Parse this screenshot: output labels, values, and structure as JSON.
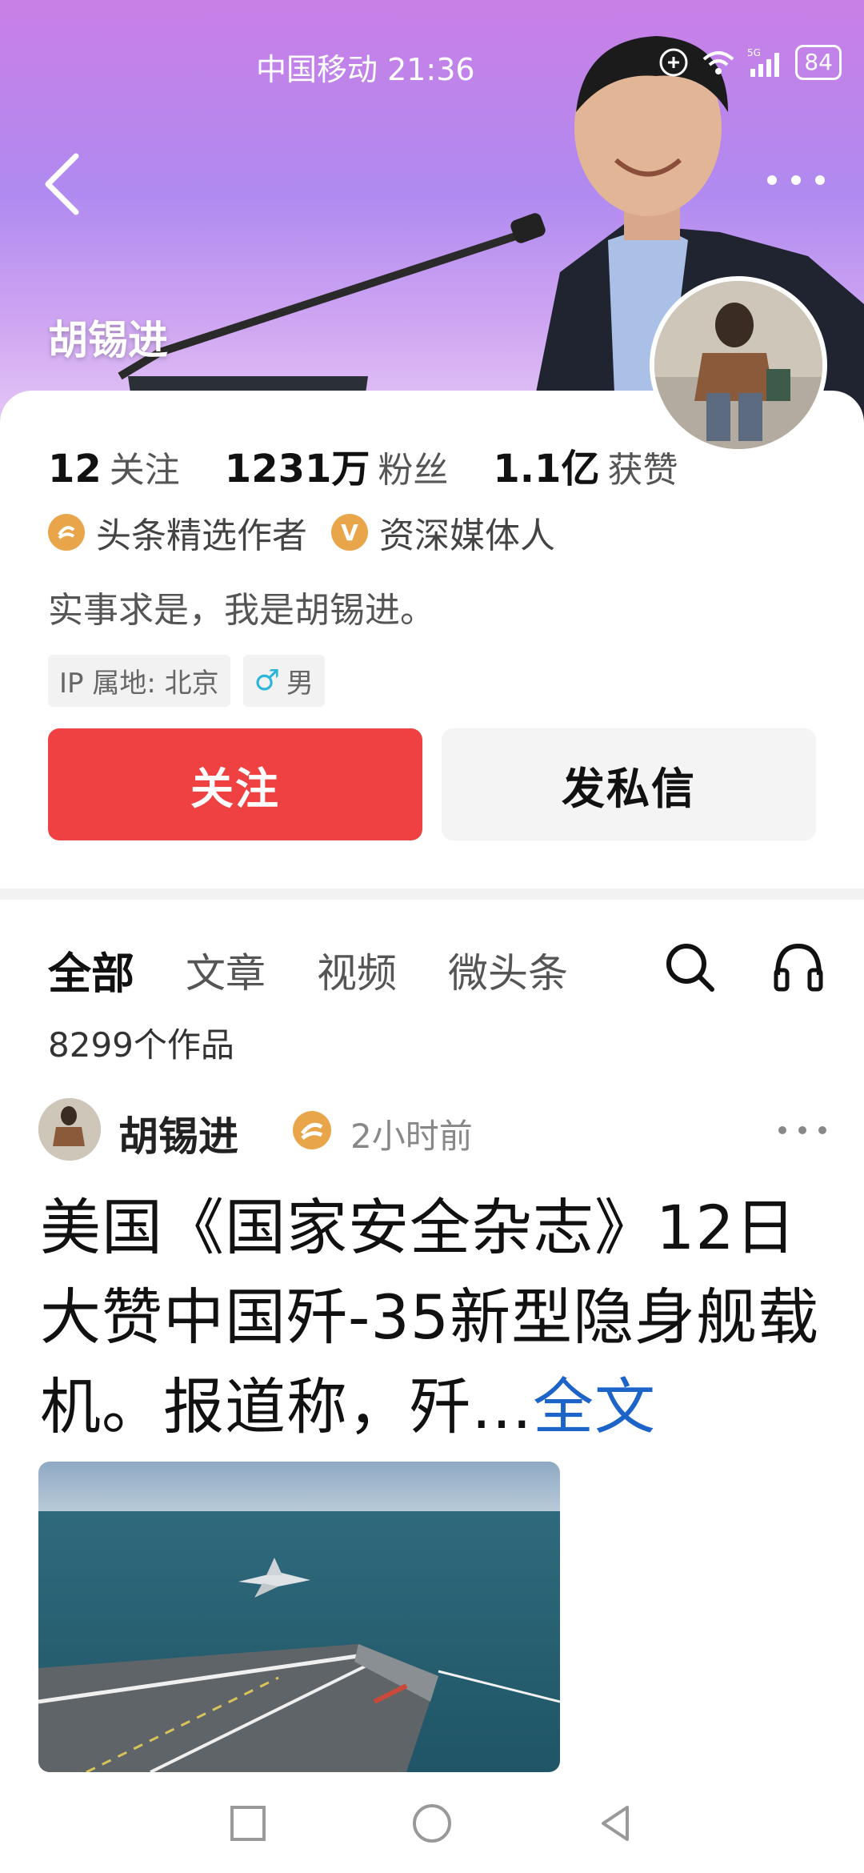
{
  "status_bar": {
    "carrier_time": "中国移动 21:36",
    "battery": "84"
  },
  "profile": {
    "name": "胡锡进",
    "stats": [
      {
        "num": "12",
        "label": "关注"
      },
      {
        "num": "1231万",
        "label": "粉丝"
      },
      {
        "num": "1.1亿",
        "label": "获赞"
      }
    ],
    "badges": [
      {
        "label": "头条精选作者",
        "icon": "headline-author-icon"
      },
      {
        "label": "资深媒体人",
        "icon": "verified-v-icon",
        "icon_text": "V"
      }
    ],
    "bio": "实事求是，我是胡锡进。",
    "tags": [
      {
        "label": "IP 属地: 北京"
      },
      {
        "label": "男",
        "icon": "male-icon"
      }
    ],
    "follow_button": "关注",
    "message_button": "发私信"
  },
  "tabs": [
    {
      "label": "全部",
      "active": true
    },
    {
      "label": "文章",
      "active": false
    },
    {
      "label": "视频",
      "active": false
    },
    {
      "label": "微头条",
      "active": false
    }
  ],
  "works_count": "8299个作品",
  "post": {
    "author": "胡锡进",
    "time": "2小时前",
    "text": "美国《国家安全杂志》12日大赞中国歼-35新型隐身舰载机。报道称，歼…",
    "full_link": "全文"
  },
  "colors": {
    "accent_red": "#f04142",
    "link_blue": "#1c64c8",
    "badge_orange": "#e8a54a"
  }
}
